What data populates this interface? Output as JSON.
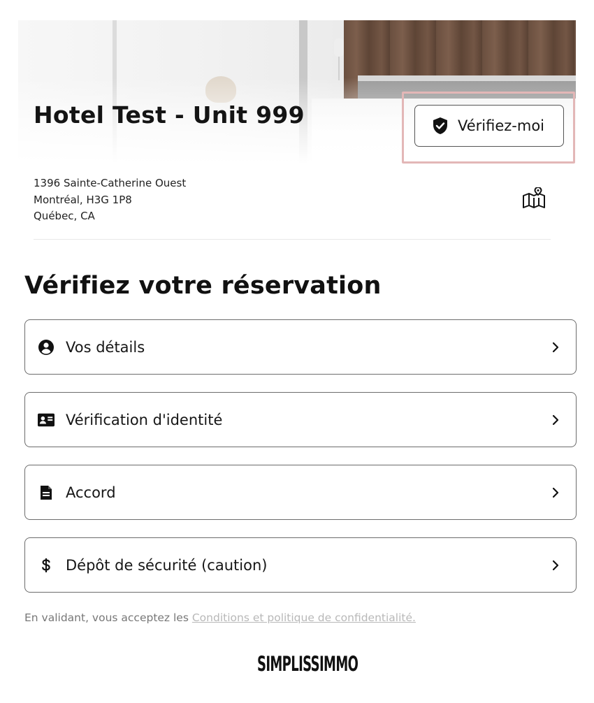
{
  "listing": {
    "title": "Hotel Test - Unit 999",
    "address_line1": "1396 Sainte-Catherine Ouest",
    "address_line2": "Montréal, H3G 1P8",
    "address_line3": "Québec, CA"
  },
  "verify_button": {
    "label": "Vérifiez-moi",
    "icon": "shield-check-icon"
  },
  "map_button": {
    "icon": "map-pin-icon"
  },
  "section": {
    "title": "Vérifiez votre réservation"
  },
  "steps": [
    {
      "label": "Vos détails",
      "icon": "account-circle-icon"
    },
    {
      "label": "Vérification d'identité",
      "icon": "id-card-icon"
    },
    {
      "label": "Accord",
      "icon": "document-icon"
    },
    {
      "label": "Dépôt de sécurité (caution)",
      "icon": "dollar-icon"
    }
  ],
  "footer": {
    "terms_prefix": "En validant, vous acceptez les",
    "terms_link": "Conditions et politique de confidentialité.",
    "brand": "SIMPLISSIMMO"
  },
  "colors": {
    "highlight_border": "#e3b7b7",
    "card_border": "#6c6c6c",
    "link": "#b8b8b8",
    "text_muted": "#777777"
  }
}
